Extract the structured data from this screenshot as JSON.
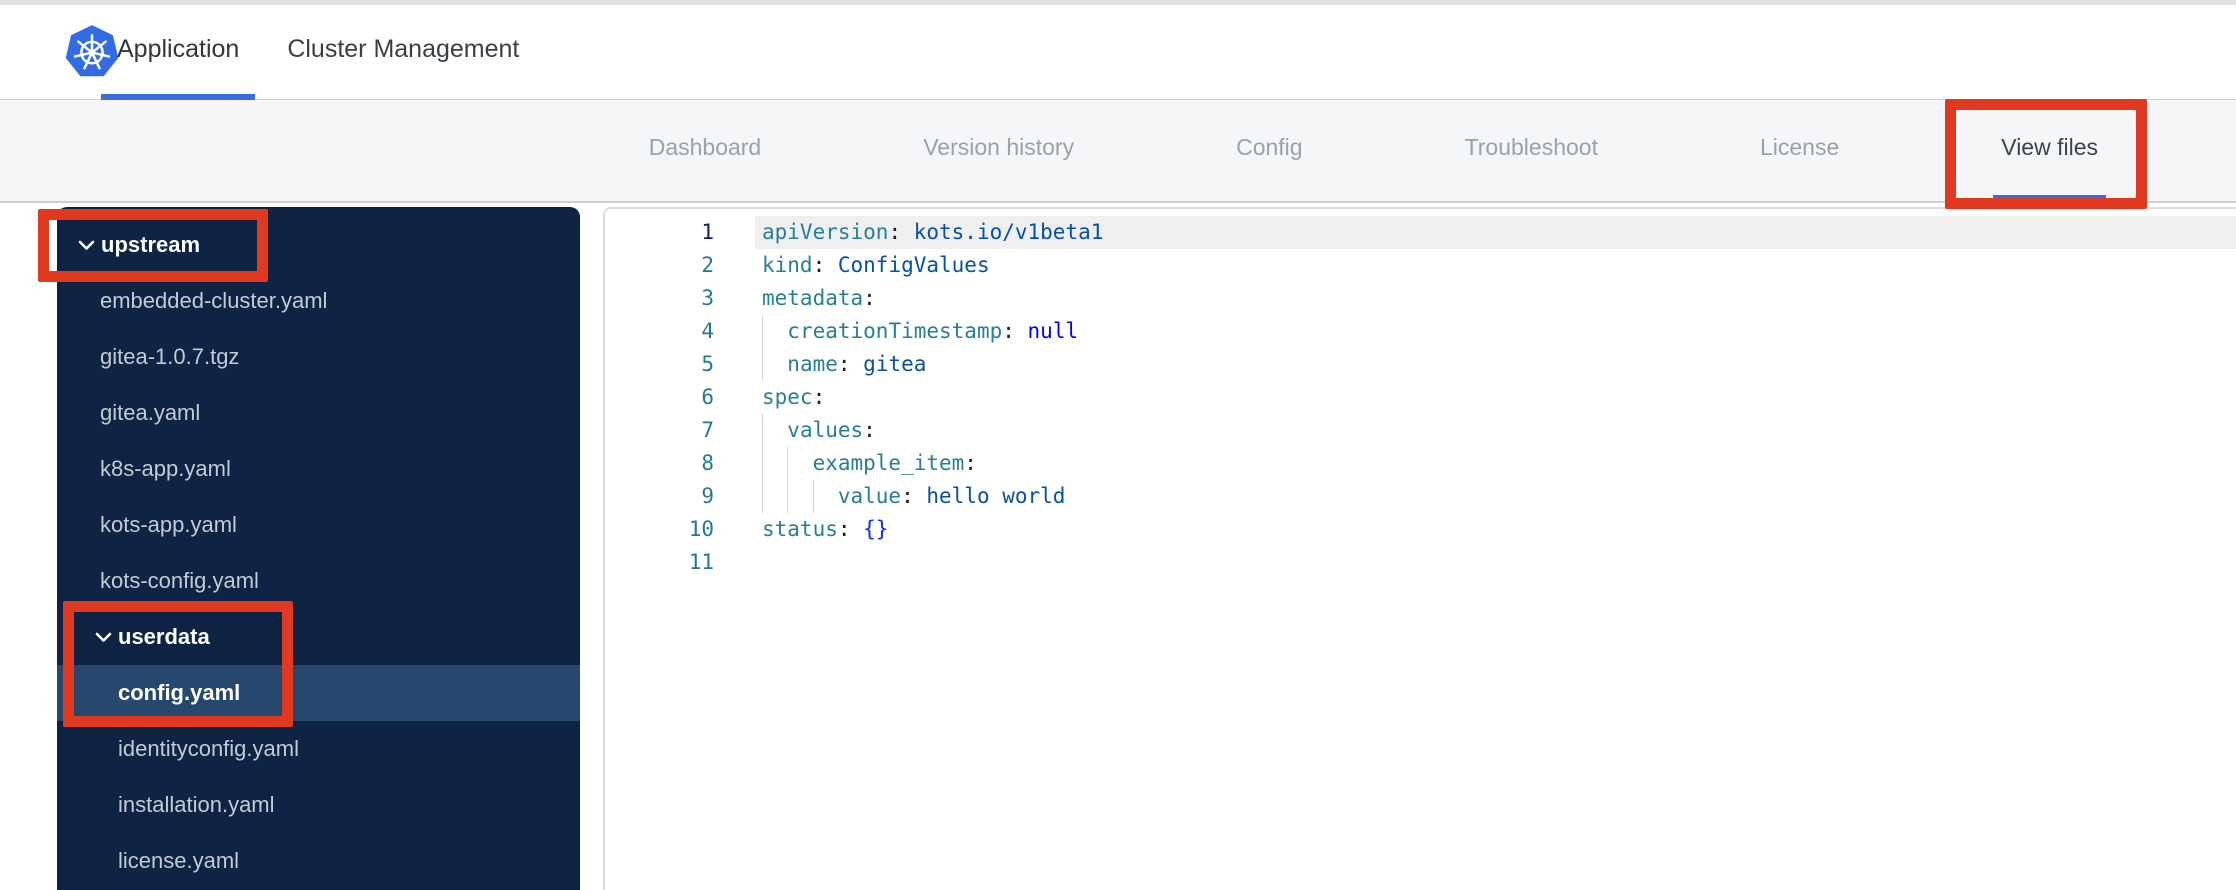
{
  "header": {
    "tabs": [
      {
        "label": "Application",
        "active": true
      },
      {
        "label": "Cluster Management",
        "active": false
      }
    ]
  },
  "subnav": {
    "tabs": [
      {
        "label": "Dashboard",
        "active": false
      },
      {
        "label": "Version history",
        "active": false
      },
      {
        "label": "Config",
        "active": false
      },
      {
        "label": "Troubleshoot",
        "active": false
      },
      {
        "label": "License",
        "active": false
      },
      {
        "label": "View files",
        "active": true,
        "annotated": true
      }
    ]
  },
  "file_tree": {
    "items": [
      {
        "label": "upstream",
        "kind": "folder",
        "level": 1,
        "expanded": true,
        "annotated": true
      },
      {
        "label": "embedded-cluster.yaml",
        "kind": "file",
        "level": 2
      },
      {
        "label": "gitea-1.0.7.tgz",
        "kind": "file",
        "level": 2
      },
      {
        "label": "gitea.yaml",
        "kind": "file",
        "level": 2
      },
      {
        "label": "k8s-app.yaml",
        "kind": "file",
        "level": 2
      },
      {
        "label": "kots-app.yaml",
        "kind": "file",
        "level": 2
      },
      {
        "label": "kots-config.yaml",
        "kind": "file",
        "level": 2
      },
      {
        "label": "userdata",
        "kind": "folder",
        "level": 2,
        "expanded": true,
        "annotated": true
      },
      {
        "label": "config.yaml",
        "kind": "file",
        "level": 3,
        "selected": true,
        "annotated": true
      },
      {
        "label": "identityconfig.yaml",
        "kind": "file",
        "level": 3
      },
      {
        "label": "installation.yaml",
        "kind": "file",
        "level": 3
      },
      {
        "label": "license.yaml",
        "kind": "file",
        "level": 3
      }
    ]
  },
  "editor": {
    "active_line": 1,
    "lines": [
      {
        "number": 1,
        "indent": 0,
        "tokens": [
          {
            "type": "key",
            "text": "apiVersion"
          },
          {
            "type": "punct",
            "text": ":"
          },
          {
            "type": "string",
            "text": " kots.io/v1beta1"
          }
        ]
      },
      {
        "number": 2,
        "indent": 0,
        "tokens": [
          {
            "type": "key",
            "text": "kind"
          },
          {
            "type": "punct",
            "text": ":"
          },
          {
            "type": "string",
            "text": " ConfigValues"
          }
        ]
      },
      {
        "number": 3,
        "indent": 0,
        "tokens": [
          {
            "type": "key",
            "text": "metadata"
          },
          {
            "type": "punct",
            "text": ":"
          }
        ]
      },
      {
        "number": 4,
        "indent": 2,
        "tokens": [
          {
            "type": "key",
            "text": "creationTimestamp"
          },
          {
            "type": "punct",
            "text": ":"
          },
          {
            "type": "keyword",
            "text": " null"
          }
        ]
      },
      {
        "number": 5,
        "indent": 2,
        "tokens": [
          {
            "type": "key",
            "text": "name"
          },
          {
            "type": "punct",
            "text": ":"
          },
          {
            "type": "string",
            "text": " gitea"
          }
        ]
      },
      {
        "number": 6,
        "indent": 0,
        "tokens": [
          {
            "type": "key",
            "text": "spec"
          },
          {
            "type": "punct",
            "text": ":"
          }
        ]
      },
      {
        "number": 7,
        "indent": 2,
        "tokens": [
          {
            "type": "key",
            "text": "values"
          },
          {
            "type": "punct",
            "text": ":"
          }
        ]
      },
      {
        "number": 8,
        "indent": 4,
        "tokens": [
          {
            "type": "key",
            "text": "example_item"
          },
          {
            "type": "punct",
            "text": ":"
          }
        ]
      },
      {
        "number": 9,
        "indent": 6,
        "tokens": [
          {
            "type": "key",
            "text": "value"
          },
          {
            "type": "punct",
            "text": ":"
          },
          {
            "type": "string",
            "text": " hello world"
          }
        ]
      },
      {
        "number": 10,
        "indent": 0,
        "tokens": [
          {
            "type": "key",
            "text": "status"
          },
          {
            "type": "punct",
            "text": ":"
          },
          {
            "type": "bracket",
            "text": " {}"
          }
        ]
      },
      {
        "number": 11,
        "indent": 0,
        "tokens": []
      }
    ]
  },
  "icons": {
    "logo": "kubernetes-logo",
    "folder_chevron": "chevron-down"
  },
  "colors": {
    "brand_blue": "#326ce5",
    "tab_underline": "#3b6ce0",
    "annotation_red": "#e0391f",
    "sidebar_bg": "#0f2444",
    "sidebar_selected": "#26476e",
    "token_key": "#267f99",
    "token_string": "#0451a5",
    "token_keyword": "#0000ff",
    "token_bracket": "#0431fa",
    "line_number": "#237893",
    "line_number_active": "#0b216f"
  }
}
